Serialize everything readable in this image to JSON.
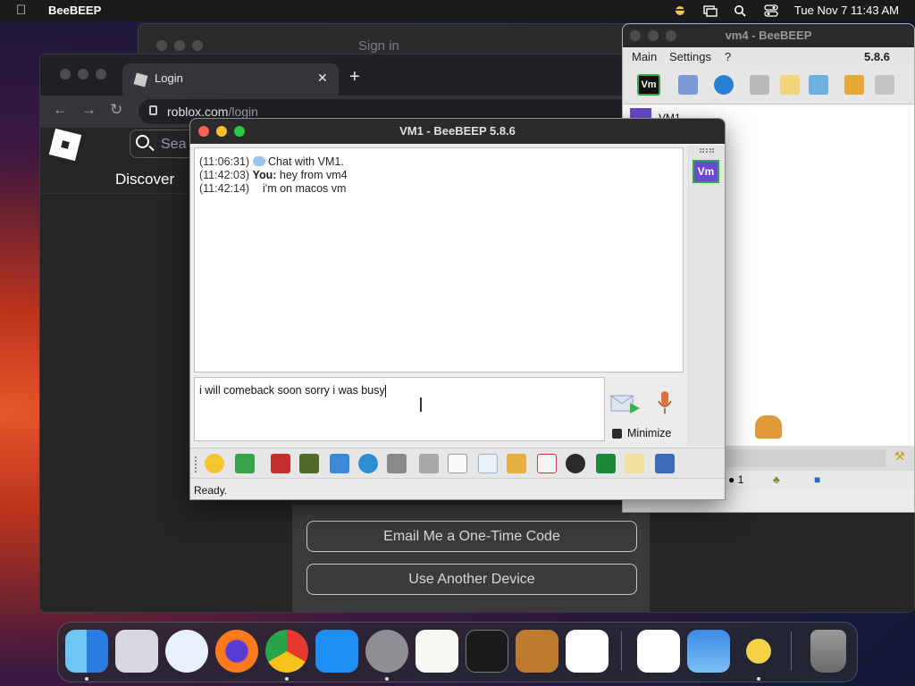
{
  "menubar": {
    "app_name": "BeeBEEP",
    "datetime": "Tue Nov 7  11:43 AM"
  },
  "background_window": {
    "title": "Sign in"
  },
  "chrome": {
    "tab_title": "Login",
    "url_host": "roblox.com",
    "url_path": "/login",
    "search_placeholder": "Sea",
    "nav_discover": "Discover",
    "email_code_button": "Email Me a One-Time Code",
    "another_device_button": "Use Another Device"
  },
  "vm4_window": {
    "title": "vm4 - BeeBEEP",
    "menu": [
      "Main",
      "Settings",
      "?"
    ],
    "version": "5.8.6",
    "user_item": "VM1",
    "online_count": "1"
  },
  "vm1_window": {
    "title": "VM1 - BeeBEEP 5.8.6",
    "messages": [
      {
        "time": "(11:06:31)",
        "sender": "",
        "text": "Chat with VM1."
      },
      {
        "time": "(11:42:03)",
        "sender": "You:",
        "text": "hey from vm4"
      },
      {
        "time": "(11:42:14)",
        "sender": "",
        "text": "i'm on macos vm"
      }
    ],
    "input_text": "i will comeback soon sorry i was busy",
    "side_badge": "Vm",
    "minimize_label": "Minimize",
    "status": "Ready."
  },
  "colors": {
    "close": "#ff5f57",
    "minimize": "#febc2e",
    "zoom": "#28c840",
    "accent_purple": "#6a4bd0"
  },
  "dock": {
    "apps": [
      "finder-icon",
      "launchpad-icon",
      "safari-icon",
      "firefox-icon",
      "chrome-icon",
      "app-store-icon",
      "system-settings-icon",
      "textedit-icon",
      "terminal-icon",
      "garageband-icon",
      "vscode-icon",
      "visual-studio-icon",
      "weather-icon",
      "beebeep-icon",
      "trash-icon"
    ]
  }
}
